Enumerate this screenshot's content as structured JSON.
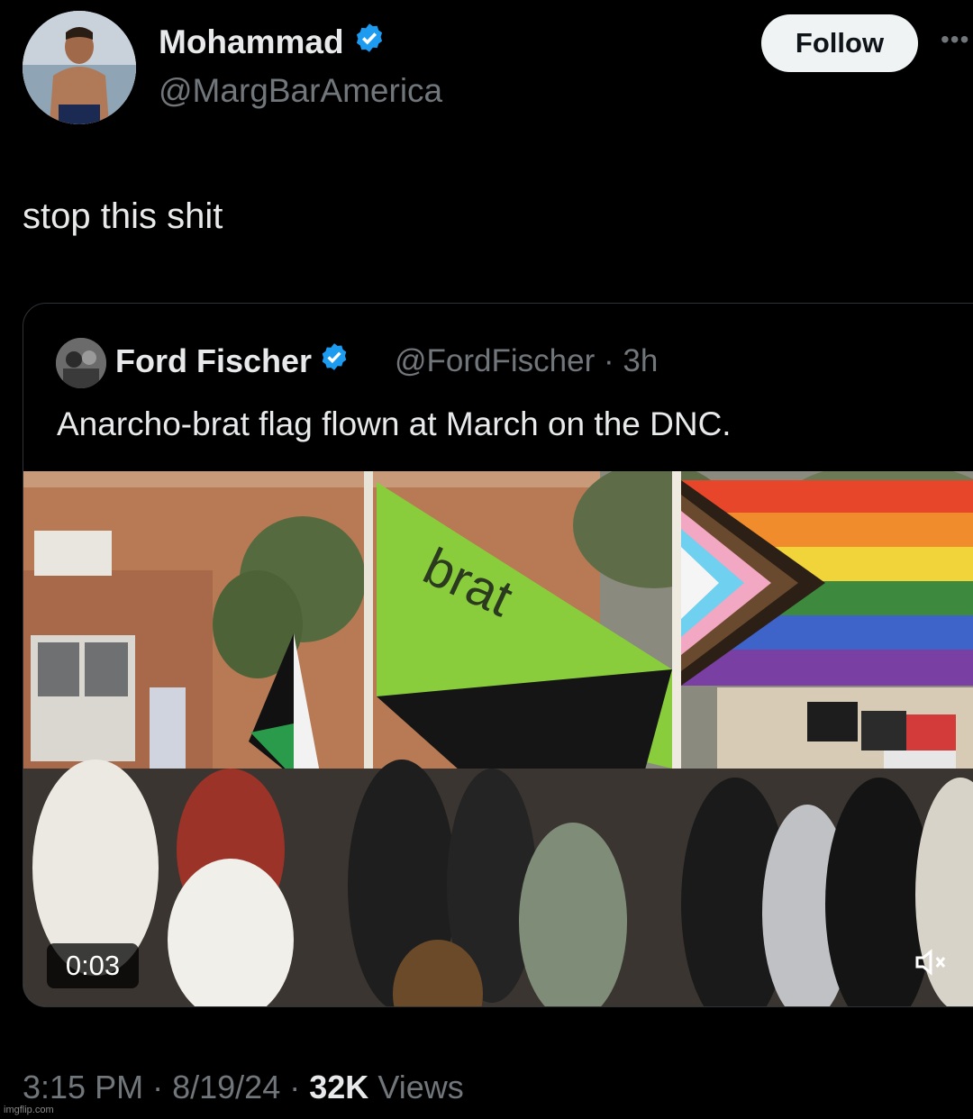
{
  "author": {
    "display_name": "Mohammad",
    "handle": "@MargBarAmerica",
    "verified_icon": "verified-badge-icon",
    "follow_label": "Follow",
    "more_icon": "more-options-icon"
  },
  "tweet": {
    "text": "stop this shit"
  },
  "quoted": {
    "display_name": "Ford Fischer",
    "handle": "@FordFischer",
    "separator": "·",
    "age": "3h",
    "text": "Anarcho-brat flag flown at March on the DNC.",
    "video": {
      "duration": "0:03",
      "flag_text": "brat",
      "mute_icon": "volume-muted-icon"
    }
  },
  "footer": {
    "time": "3:15 PM",
    "sep1": "·",
    "date": "8/19/24",
    "sep2": "·",
    "views_count": "32K",
    "views_label": "Views"
  },
  "watermark": "imgflip.com",
  "colors": {
    "background": "#000000",
    "text_primary": "#e7e9ea",
    "text_secondary": "#71767b",
    "verified_blue": "#1d9bf0",
    "brat_green": "#8acd3c",
    "border": "#2f3336"
  }
}
